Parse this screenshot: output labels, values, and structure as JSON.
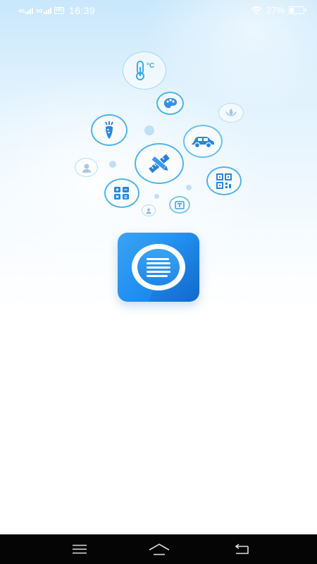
{
  "status_bar": {
    "network_1": "4G",
    "network_2": "5G",
    "hd_badge": "HD",
    "time": "16:39",
    "battery_percent": "27%",
    "battery_level": 0.27,
    "icons": [
      "signal-icon",
      "wifi-icon",
      "battery-icon"
    ]
  },
  "splash": {
    "app_icon": "list-document-icon",
    "feature_icons": [
      "thermometer-celsius-icon",
      "palette-icon",
      "lotus-icon",
      "carrot-icon",
      "car-icon",
      "pencil-ruler-icon",
      "person-silhouette-icon",
      "calculator-icon",
      "qr-code-icon",
      "contact-icon",
      "text-box-icon"
    ],
    "temperature_unit": "°C",
    "accent_color": "#1f8ef0",
    "ring_color": "#4fb3ec"
  },
  "nav_bar": {
    "buttons": [
      "menu-icon",
      "home-icon",
      "back-icon"
    ]
  }
}
